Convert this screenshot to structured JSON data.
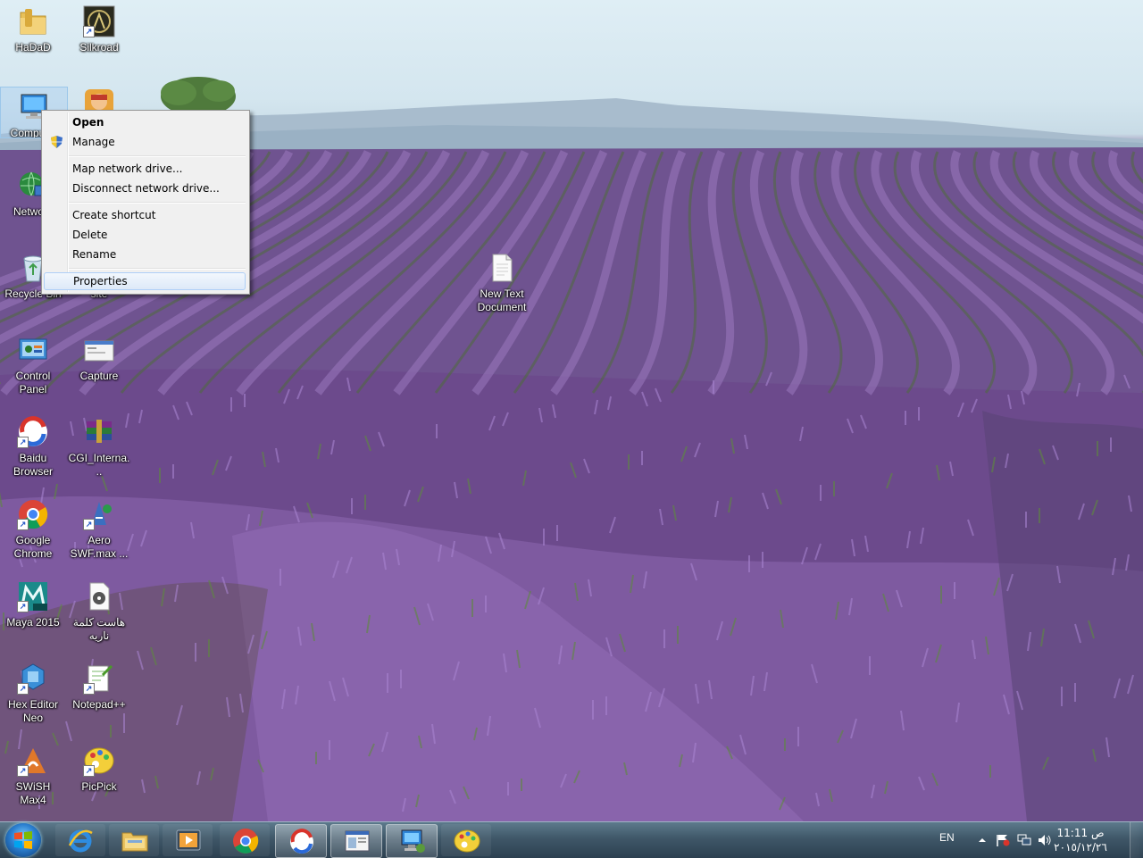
{
  "desktop": {
    "icons": [
      {
        "label": "HaDaD",
        "icon": "folder-icon"
      },
      {
        "label": "Silkroad",
        "icon": "silkroad-game-icon"
      },
      {
        "label": "Computer",
        "icon": "computer-icon"
      },
      {
        "label": "",
        "icon": "subway-surfers-icon"
      },
      {
        "label": "",
        "icon": "tree-icon"
      },
      {
        "label": "Network",
        "icon": "network-icon"
      },
      {
        "label": "Recycle Bin",
        "icon": "recycle-bin-icon"
      },
      {
        "label": "site",
        "icon": "site-icon"
      },
      {
        "label": "New Text Document",
        "icon": "text-document-icon"
      },
      {
        "label": "Control Panel",
        "icon": "control-panel-icon"
      },
      {
        "label": "Capture",
        "icon": "capture-icon"
      },
      {
        "label": "Baidu Browser",
        "icon": "baidu-browser-icon"
      },
      {
        "label": "CGI_Interna...",
        "icon": "winrar-archive-icon"
      },
      {
        "label": "Google Chrome",
        "icon": "chrome-icon"
      },
      {
        "label": "Aero SWF.max ...",
        "icon": "aero-swf-icon"
      },
      {
        "label": "Maya 2015",
        "icon": "maya-icon"
      },
      {
        "label": "هاست كلمة ناريه",
        "icon": "media-file-icon"
      },
      {
        "label": "Hex Editor Neo",
        "icon": "hex-editor-icon"
      },
      {
        "label": "Notepad++",
        "icon": "notepad-plus-plus-icon"
      },
      {
        "label": "SWiSH Max4",
        "icon": "swish-max-icon"
      },
      {
        "label": "PicPick",
        "icon": "picpick-icon"
      }
    ]
  },
  "context_menu": {
    "items": [
      {
        "label": "Open",
        "bold": true
      },
      {
        "label": "Manage",
        "icon": "uac-shield-icon"
      },
      {
        "label": "Map network drive..."
      },
      {
        "label": "Disconnect network drive..."
      },
      {
        "label": "Create shortcut"
      },
      {
        "label": "Delete"
      },
      {
        "label": "Rename"
      },
      {
        "label": "Properties",
        "highlighted": true
      }
    ]
  },
  "taskbar": {
    "start_icon": "windows-start-icon",
    "apps": [
      {
        "icon": "internet-explorer-icon",
        "state": "pinned"
      },
      {
        "icon": "windows-explorer-icon",
        "state": "pinned"
      },
      {
        "icon": "media-player-icon",
        "state": "pinned"
      },
      {
        "icon": "chrome-icon",
        "state": "pinned"
      },
      {
        "icon": "baidu-browser-icon",
        "state": "running"
      },
      {
        "icon": "capture-window-icon",
        "state": "running"
      },
      {
        "icon": "computer-management-icon",
        "state": "running"
      },
      {
        "icon": "picpick-icon",
        "state": "pinned"
      }
    ],
    "tray": {
      "language": "EN",
      "time": "11:11 ص",
      "date": "٢٠١٥/١٢/٢٦"
    }
  },
  "colors": {
    "taskbar": "#3f5768",
    "menu_background": "#f0f0f0",
    "menu_highlight": "#dde9f8",
    "lavender": "#6e4d8c",
    "sky": "#dfeef5"
  }
}
